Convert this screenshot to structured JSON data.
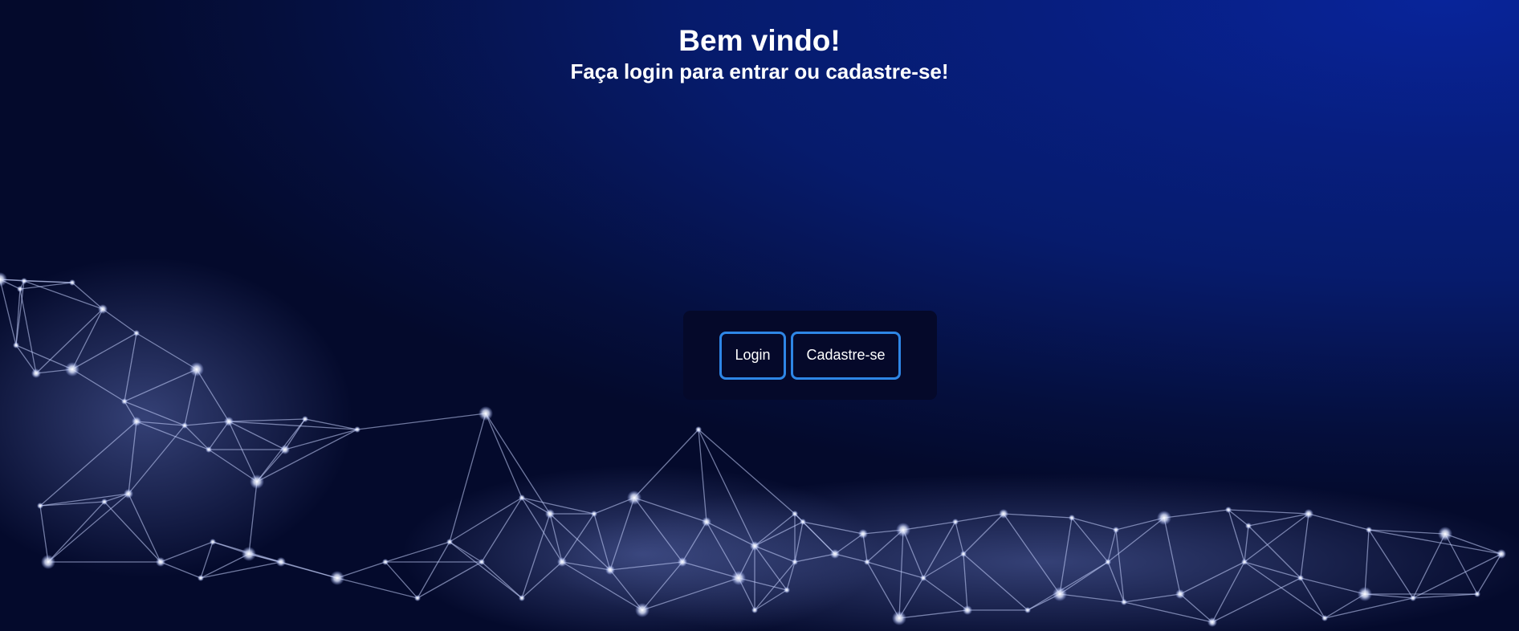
{
  "header": {
    "title": "Bem vindo!",
    "subtitle": "Faça login para entrar ou cadastre-se!"
  },
  "actions": {
    "login_label": "Login",
    "signup_label": "Cadastre-se"
  },
  "colors": {
    "background_deep": "#040a2c",
    "background_bright": "#08249a",
    "panel": "#05092a",
    "button_border": "#2e86e6",
    "text": "#ffffff"
  }
}
